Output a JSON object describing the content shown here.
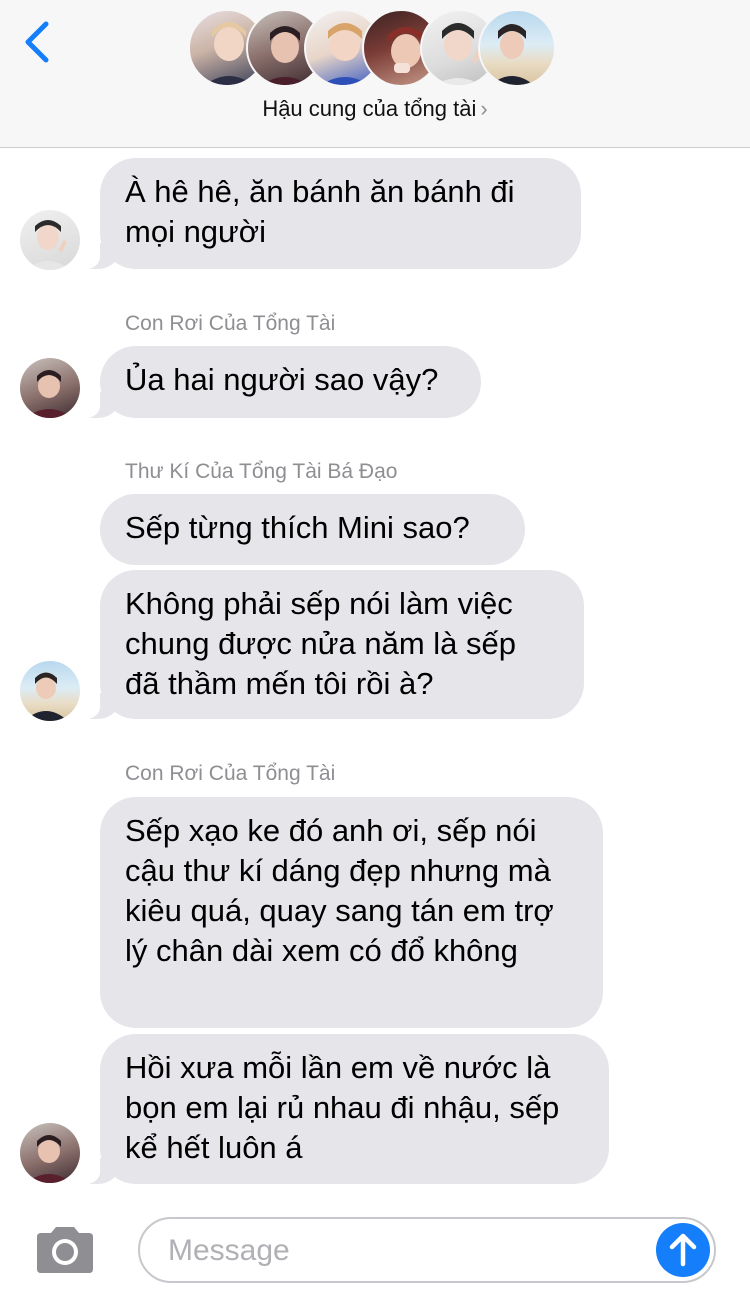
{
  "header": {
    "back_icon": "chevron-left-icon",
    "group_name": "Hậu cung của tổng tài",
    "chevron": "›",
    "accent": "#147efb"
  },
  "messages": [
    {
      "sender": "",
      "text": "À hê hê, ăn bánh ăn bánh đi mọi người"
    },
    {
      "sender": "Con Rơi Của Tổng Tài",
      "text": "Ủa hai người sao vậy?"
    },
    {
      "sender": "Thư Kí Của Tổng Tài Bá Đạo",
      "text": "Sếp từng thích Mini sao?"
    },
    {
      "sender": "",
      "text": "Không phải sếp nói làm việc chung được nửa năm là sếp đã thầm mến tôi rồi à?"
    },
    {
      "sender": "Con Rơi Của Tổng Tài",
      "text": "Sếp xạo ke đó anh ơi, sếp nói cậu thư kí dáng đẹp nhưng mà kiêu quá, quay sang tán em trợ lý chân dài xem có đổ không"
    },
    {
      "sender": "",
      "text": "Hồi xưa mỗi lần em về nước là bọn em lại rủ nhau đi nhậu, sếp kể hết luôn á"
    }
  ],
  "composer": {
    "placeholder": "Message",
    "camera_icon": "camera-icon",
    "send_icon": "arrow-up-icon"
  },
  "colors": {
    "bubble": "#e5e5ea",
    "sender_text": "#8e8e93",
    "send_button": "#147efb"
  }
}
